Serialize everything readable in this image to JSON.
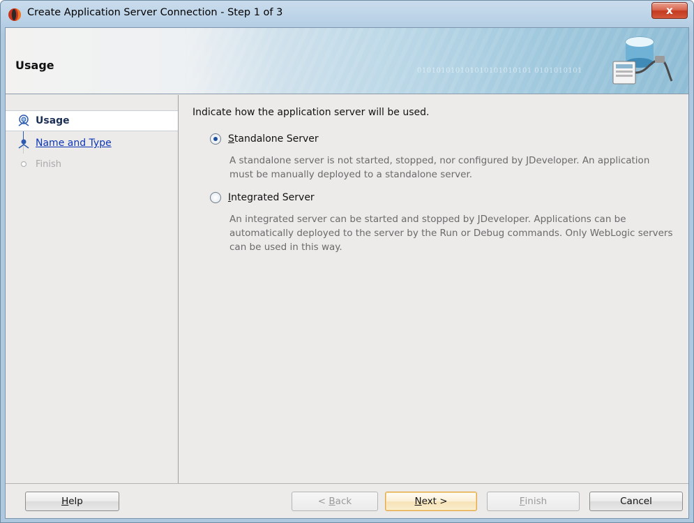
{
  "window": {
    "title": "Create Application Server Connection - Step 1 of 3",
    "close_glyph": "x"
  },
  "banner": {
    "title": "Usage",
    "binary_text": "010101010101010101010101 0101010101"
  },
  "nav": {
    "items": [
      {
        "label": "Usage",
        "state": "current"
      },
      {
        "label": "Name and Type",
        "state": "link"
      },
      {
        "label": "Finish",
        "state": "disabled"
      }
    ]
  },
  "content": {
    "prompt": "Indicate how  the application server will be used.",
    "options": [
      {
        "label_mnemonic": "S",
        "label_rest": "tandalone Server",
        "selected": true,
        "description": "A standalone server is not started, stopped, nor configured by JDeveloper. An application must be manually deployed to a standalone server."
      },
      {
        "label_mnemonic": "I",
        "label_rest": "ntegrated Server",
        "selected": false,
        "description": "An integrated server can be started and stopped by JDeveloper. Applications can be automatically deployed to the server by the Run or Debug commands. Only WebLogic servers can be used in this way."
      }
    ]
  },
  "buttons": {
    "help_mnemonic": "H",
    "help_rest": "elp",
    "back_prefix": "< ",
    "back_mnemonic": "B",
    "back_rest": "ack",
    "next_mnemonic": "N",
    "next_rest": "ext >",
    "finish_mnemonic": "F",
    "finish_rest": "inish",
    "cancel": "Cancel"
  },
  "colors": {
    "link": "#0b36b6",
    "selected_nav_text": "#1b2f55",
    "default_button_border": "#e3a64a",
    "close_button": "#c33a1f"
  }
}
